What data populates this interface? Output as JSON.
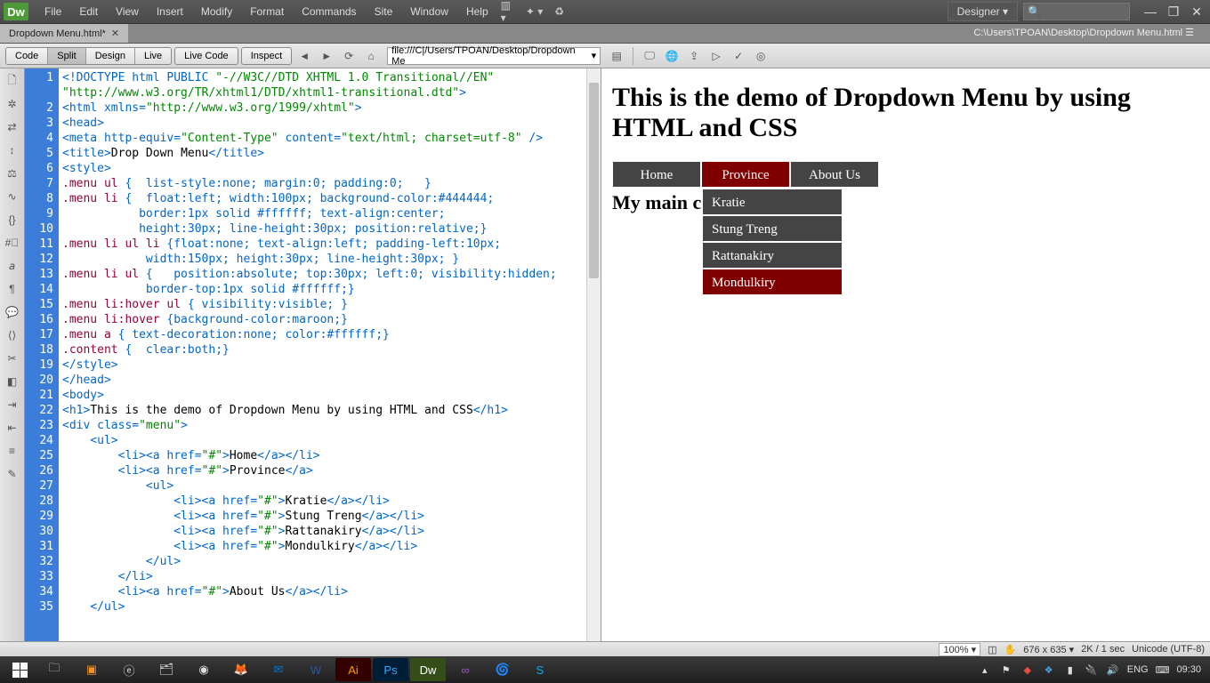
{
  "app": {
    "logo": "Dw"
  },
  "menubar": [
    "File",
    "Edit",
    "View",
    "Insert",
    "Modify",
    "Format",
    "Commands",
    "Site",
    "Window",
    "Help"
  ],
  "workspace": "Designer",
  "window_controls": {
    "min": "—",
    "max": "❐",
    "close": "✕"
  },
  "doc": {
    "tab": "Dropdown Menu.html*",
    "path": "C:\\Users\\TPOAN\\Desktop\\Dropdown Menu.html"
  },
  "toolbar": {
    "views": [
      "Code",
      "Split",
      "Design",
      "Live"
    ],
    "live_code": "Live Code",
    "inspect": "Inspect",
    "address": "file:///C|/Users/TPOAN/Desktop/Dropdown Me"
  },
  "code": {
    "lines": [
      {
        "n": 1,
        "seg": [
          {
            "c": "c-blue",
            "t": "<!DOCTYPE html PUBLIC "
          },
          {
            "c": "c-green",
            "t": "\"-//W3C//DTD XHTML 1.0 Transitional//EN\""
          }
        ]
      },
      {
        "seg": [
          {
            "c": "c-green",
            "t": "\"http://www.w3.org/TR/xhtml1/DTD/xhtml1-transitional.dtd\""
          },
          {
            "c": "c-blue",
            "t": ">"
          }
        ]
      },
      {
        "n": 2,
        "seg": [
          {
            "c": "c-blue",
            "t": "<html "
          },
          {
            "c": "c-blue",
            "t": "xmlns="
          },
          {
            "c": "c-green",
            "t": "\"http://www.w3.org/1999/xhtml\""
          },
          {
            "c": "c-blue",
            "t": ">"
          }
        ]
      },
      {
        "n": 3,
        "seg": [
          {
            "c": "c-blue",
            "t": "<head>"
          }
        ]
      },
      {
        "n": 4,
        "seg": [
          {
            "c": "c-blue",
            "t": "<meta "
          },
          {
            "c": "c-blue",
            "t": "http-equiv="
          },
          {
            "c": "c-green",
            "t": "\"Content-Type\""
          },
          {
            "c": "c-blue",
            "t": " content="
          },
          {
            "c": "c-green",
            "t": "\"text/html; charset=utf-8\""
          },
          {
            "c": "c-blue",
            "t": " />"
          }
        ]
      },
      {
        "n": 5,
        "seg": [
          {
            "c": "c-blue",
            "t": "<title>"
          },
          {
            "c": "c-black",
            "t": "Drop Down Menu"
          },
          {
            "c": "c-blue",
            "t": "</title>"
          }
        ]
      },
      {
        "n": 6,
        "seg": [
          {
            "c": "c-blue",
            "t": "<style>"
          }
        ]
      },
      {
        "n": 7,
        "seg": [
          {
            "c": "c-maroon",
            "t": ".menu ul"
          },
          {
            "c": "c-blue",
            "t": " {  list-style:none; margin:0; padding:0;   }"
          }
        ]
      },
      {
        "n": 8,
        "seg": [
          {
            "c": "c-maroon",
            "t": ".menu li"
          },
          {
            "c": "c-blue",
            "t": " {  float:left; width:100px; background-color:#444444;"
          }
        ]
      },
      {
        "n": 9,
        "seg": [
          {
            "c": "c-blue",
            "t": "           border:1px solid #ffffff; text-align:center;"
          }
        ]
      },
      {
        "n": 10,
        "seg": [
          {
            "c": "c-blue",
            "t": "           height:30px; line-height:30px; position:relative;}"
          }
        ]
      },
      {
        "n": 11,
        "seg": [
          {
            "c": "c-maroon",
            "t": ".menu li ul li"
          },
          {
            "c": "c-blue",
            "t": " {float:none; text-align:left; padding-left:10px;"
          }
        ]
      },
      {
        "n": 12,
        "seg": [
          {
            "c": "c-blue",
            "t": "            width:150px; height:30px; line-height:30px; }"
          }
        ]
      },
      {
        "n": 13,
        "seg": [
          {
            "c": "c-maroon",
            "t": ".menu li ul"
          },
          {
            "c": "c-blue",
            "t": " {   position:absolute; top:30px; left:0; visibility:hidden;"
          }
        ]
      },
      {
        "n": 14,
        "seg": [
          {
            "c": "c-blue",
            "t": "            border-top:1px solid #ffffff;}"
          }
        ]
      },
      {
        "n": 15,
        "seg": [
          {
            "c": "c-maroon",
            "t": ".menu li:hover ul"
          },
          {
            "c": "c-blue",
            "t": " { visibility:visible; }"
          }
        ]
      },
      {
        "n": 16,
        "seg": [
          {
            "c": "c-maroon",
            "t": ".menu li:hover"
          },
          {
            "c": "c-blue",
            "t": " {background-color:maroon;}"
          }
        ]
      },
      {
        "n": 17,
        "seg": [
          {
            "c": "c-maroon",
            "t": ".menu a"
          },
          {
            "c": "c-blue",
            "t": " { text-decoration:none; color:#ffffff;}"
          }
        ]
      },
      {
        "n": 18,
        "seg": [
          {
            "c": "c-maroon",
            "t": ".content"
          },
          {
            "c": "c-blue",
            "t": " {  clear:both;}"
          }
        ]
      },
      {
        "n": 19,
        "seg": [
          {
            "c": "c-blue",
            "t": "</style>"
          }
        ]
      },
      {
        "n": 20,
        "seg": [
          {
            "c": "c-blue",
            "t": "</head>"
          }
        ]
      },
      {
        "n": 21,
        "seg": [
          {
            "c": "c-blue",
            "t": "<body>"
          }
        ]
      },
      {
        "n": 22,
        "seg": [
          {
            "c": "c-blue",
            "t": "<h1>"
          },
          {
            "c": "c-black",
            "t": "This is the demo of Dropdown Menu by using HTML and CSS"
          },
          {
            "c": "c-blue",
            "t": "</h1>"
          }
        ]
      },
      {
        "n": 23,
        "seg": [
          {
            "c": "c-blue",
            "t": "<div "
          },
          {
            "c": "c-blue",
            "t": "class="
          },
          {
            "c": "c-green",
            "t": "\"menu\""
          },
          {
            "c": "c-blue",
            "t": ">"
          }
        ]
      },
      {
        "n": 24,
        "seg": [
          {
            "c": "c-blue",
            "t": "    <ul>"
          }
        ]
      },
      {
        "n": 25,
        "seg": [
          {
            "c": "c-blue",
            "t": "        <li><a "
          },
          {
            "c": "c-blue",
            "t": "href="
          },
          {
            "c": "c-green",
            "t": "\"#\""
          },
          {
            "c": "c-blue",
            "t": ">"
          },
          {
            "c": "c-black",
            "t": "Home"
          },
          {
            "c": "c-blue",
            "t": "</a></li>"
          }
        ]
      },
      {
        "n": 26,
        "seg": [
          {
            "c": "c-blue",
            "t": "        <li><a "
          },
          {
            "c": "c-blue",
            "t": "href="
          },
          {
            "c": "c-green",
            "t": "\"#\""
          },
          {
            "c": "c-blue",
            "t": ">"
          },
          {
            "c": "c-black",
            "t": "Province"
          },
          {
            "c": "c-blue",
            "t": "</a>"
          }
        ]
      },
      {
        "n": 27,
        "seg": [
          {
            "c": "c-blue",
            "t": "            <ul>"
          }
        ]
      },
      {
        "n": 28,
        "seg": [
          {
            "c": "c-blue",
            "t": "                <li><a "
          },
          {
            "c": "c-blue",
            "t": "href="
          },
          {
            "c": "c-green",
            "t": "\"#\""
          },
          {
            "c": "c-blue",
            "t": ">"
          },
          {
            "c": "c-black",
            "t": "Kratie"
          },
          {
            "c": "c-blue",
            "t": "</a></li>"
          }
        ]
      },
      {
        "n": 29,
        "seg": [
          {
            "c": "c-blue",
            "t": "                <li><a "
          },
          {
            "c": "c-blue",
            "t": "href="
          },
          {
            "c": "c-green",
            "t": "\"#\""
          },
          {
            "c": "c-blue",
            "t": ">"
          },
          {
            "c": "c-black",
            "t": "Stung Treng"
          },
          {
            "c": "c-blue",
            "t": "</a></li>"
          }
        ]
      },
      {
        "n": 30,
        "seg": [
          {
            "c": "c-blue",
            "t": "                <li><a "
          },
          {
            "c": "c-blue",
            "t": "href="
          },
          {
            "c": "c-green",
            "t": "\"#\""
          },
          {
            "c": "c-blue",
            "t": ">"
          },
          {
            "c": "c-black",
            "t": "Rattanakiry"
          },
          {
            "c": "c-blue",
            "t": "</a></li>"
          }
        ]
      },
      {
        "n": 31,
        "seg": [
          {
            "c": "c-blue",
            "t": "                <li><a "
          },
          {
            "c": "c-blue",
            "t": "href="
          },
          {
            "c": "c-green",
            "t": "\"#\""
          },
          {
            "c": "c-blue",
            "t": ">"
          },
          {
            "c": "c-black",
            "t": "Mondulkiry"
          },
          {
            "c": "c-blue",
            "t": "</a></li>"
          }
        ]
      },
      {
        "n": 32,
        "seg": [
          {
            "c": "c-blue",
            "t": "            </ul>"
          }
        ]
      },
      {
        "n": 33,
        "seg": [
          {
            "c": "c-blue",
            "t": "        </li>"
          }
        ]
      },
      {
        "n": 34,
        "seg": [
          {
            "c": "c-blue",
            "t": "        <li><a "
          },
          {
            "c": "c-blue",
            "t": "href="
          },
          {
            "c": "c-green",
            "t": "\"#\""
          },
          {
            "c": "c-blue",
            "t": ">"
          },
          {
            "c": "c-black",
            "t": "About Us"
          },
          {
            "c": "c-blue",
            "t": "</a></li>"
          }
        ]
      },
      {
        "n": 35,
        "seg": [
          {
            "c": "c-blue",
            "t": "    </ul>"
          }
        ]
      }
    ]
  },
  "preview": {
    "h1": "This is the demo of Dropdown Menu by using HTML and CSS",
    "nav": [
      "Home",
      "Province",
      "About Us"
    ],
    "submenu": [
      "Kratie",
      "Stung Treng",
      "Rattanakiry",
      "Mondulkiry"
    ],
    "content_h2": "My main c"
  },
  "status": {
    "zoom": "100%",
    "dims": "676 x 635",
    "size": "2K / 1 sec",
    "encoding": "Unicode (UTF-8)"
  },
  "tray": {
    "lang": "ENG",
    "time": "09:30"
  }
}
